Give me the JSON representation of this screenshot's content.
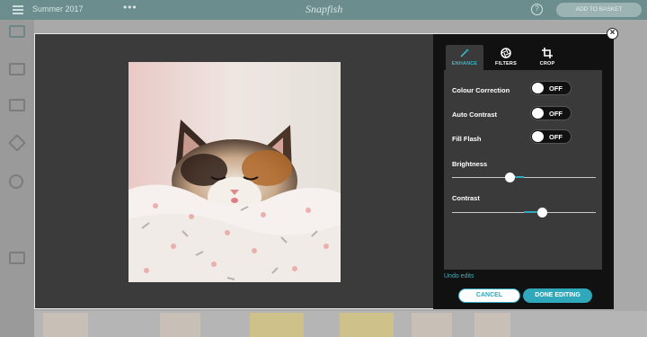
{
  "app": {
    "project_title": "Summer 2017",
    "more_label": "•••",
    "brand": "Snapfish",
    "help_label": "?",
    "cta_label": "ADD TO BASKET"
  },
  "editor": {
    "close_label": "×",
    "tabs": [
      {
        "label": "ENHANCE",
        "icon": "magic-wand-icon",
        "active": true
      },
      {
        "label": "FILTERS",
        "icon": "aperture-icon",
        "active": false
      },
      {
        "label": "CROP",
        "icon": "crop-icon",
        "active": false
      }
    ],
    "toggles": [
      {
        "label": "Colour Correction",
        "value": "OFF"
      },
      {
        "label": "Auto Contrast",
        "value": "OFF"
      },
      {
        "label": "Fill Flash",
        "value": "OFF"
      }
    ],
    "sliders": [
      {
        "label": "Brightness",
        "value": 0.4
      },
      {
        "label": "Contrast",
        "value": 0.63
      }
    ],
    "undo_label": "Undo edits",
    "cancel_label": "CANCEL",
    "done_label": "DONE EDITING",
    "accent_color": "#2fa8bb"
  }
}
